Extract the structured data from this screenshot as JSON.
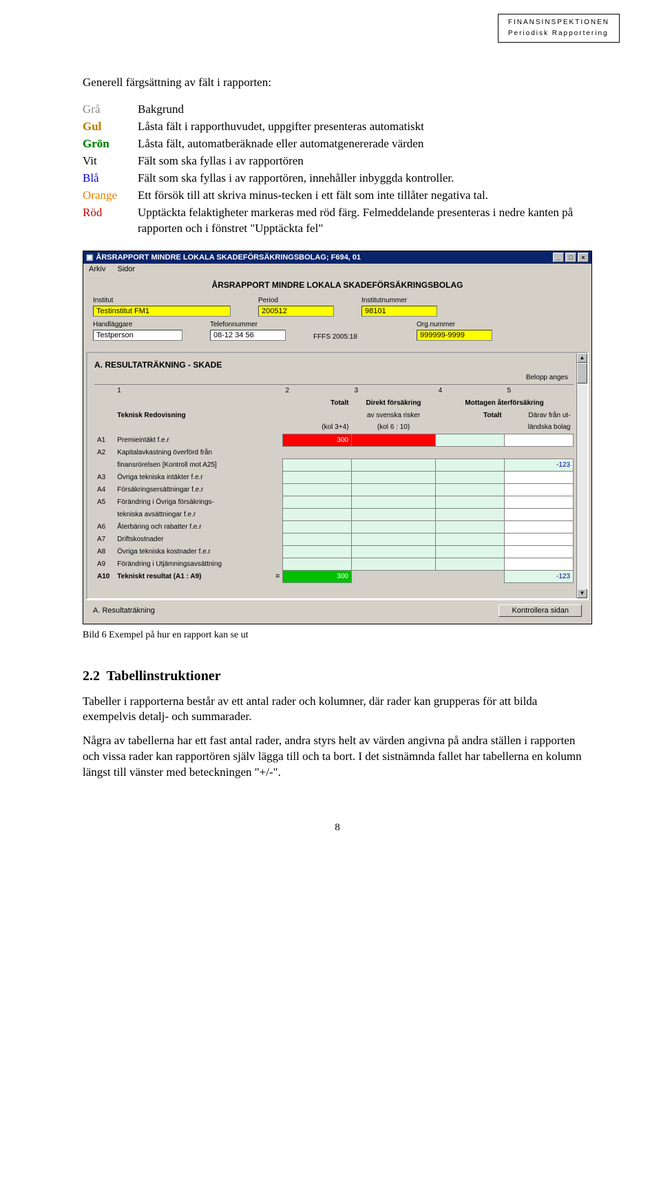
{
  "header": {
    "org": "FINANSINSPEKTIONEN",
    "sub": "Periodisk Rapportering"
  },
  "title": "Generell färgsättning av fält i rapporten:",
  "colors": [
    {
      "key": "Grå",
      "cls": "c-gra",
      "desc": "Bakgrund"
    },
    {
      "key": "Gul",
      "cls": "c-gul",
      "desc": "Låsta fält i rapporthuvudet, uppgifter presenteras automatiskt"
    },
    {
      "key": "Grön",
      "cls": "c-gron",
      "desc": "Låsta fält, automatberäknade eller automatgenererade värden"
    },
    {
      "key": "Vit",
      "cls": "c-vit",
      "desc": "Fält som ska fyllas i av rapportören"
    },
    {
      "key": "Blå",
      "cls": "c-bla",
      "desc": "Fält som ska fyllas i av rapportören, innehåller inbyggda kontroller."
    },
    {
      "key": "Orange",
      "cls": "c-orange",
      "desc": "Ett försök till att skriva minus-tecken i ett fält som inte tillåter negativa tal."
    },
    {
      "key": "Röd",
      "cls": "c-rod",
      "desc": "Upptäckta felaktigheter markeras med röd färg. Felmeddelande presenteras i nedre kanten på rapporten och i fönstret \"Upptäckta fel\""
    }
  ],
  "screenshot": {
    "titlebar": "ÅRSRAPPORT MINDRE LOKALA SKADEFÖRSÄKRINGSBOLAG; F694, 01",
    "menu": {
      "arkiv": "Arkiv",
      "sidor": "Sidor"
    },
    "main_label": "ÅRSRAPPORT MINDRE LOKALA SKADEFÖRSÄKRINGSBOLAG",
    "fields": {
      "institut_label": "Institut",
      "institut_value": "Testinstitut FM1",
      "period_label": "Period",
      "period_value": "200512",
      "institutnummer_label": "Institutnummer",
      "institutnummer_value": "98101",
      "handlaggare_label": "Handläggare",
      "handlaggare_value": "Testperson",
      "telefon_label": "Telefonnummer",
      "telefon_value": "08-12 34 56",
      "fffs": "FFFS 2005:18",
      "orgnr_label": "Org.nummer",
      "orgnr_value": "999999-9999"
    },
    "section_title": "A.  RESULTATRÄKNING - SKADE",
    "belopp": "Belopp anges",
    "table": {
      "colnums": [
        "1",
        "2",
        "3",
        "4",
        "5"
      ],
      "teknisk": "Teknisk Redovisning",
      "h_totalt": "Totalt",
      "h_direkt": "Direkt försäkring",
      "h_direkt2": "av svenska risker",
      "h_mottagen": "Mottagen återförsäkring",
      "h_mtot": "Totalt",
      "h_darav": "Därav från ut-",
      "h_darav2": "ländska bolag",
      "h_kol34": "(kol 3+4)",
      "h_kol610": "(kol 6 : 10)",
      "rows": [
        {
          "id": "A1",
          "label": "Premieintäkt f.e.r",
          "c2": "300",
          "hasRed": true
        },
        {
          "id": "A2",
          "label": "Kapitalavkastning överförd från",
          "extra": "finansrörelsen        [Kontroll mot A25]",
          "c5": "-123"
        },
        {
          "id": "A3",
          "label": "Övriga tekniska intäkter f.e.r"
        },
        {
          "id": "A4",
          "label": "Försäkringsersättningar f.e.r"
        },
        {
          "id": "A5",
          "label": "Förändring i Övriga försäkrings-",
          "extra": "tekniska avsättningar f.e.r"
        },
        {
          "id": "A6",
          "label": "Återbäring och rabatter f.e.r"
        },
        {
          "id": "A7",
          "label": "Driftskostnader"
        },
        {
          "id": "A8",
          "label": "Övriga tekniska kostnader f.e.r"
        },
        {
          "id": "A9",
          "label": "Förändring i Utjämningsavsättning"
        },
        {
          "id": "A10",
          "label": "Tekniskt resultat (A1 : A9)",
          "bold": true,
          "eq": "=",
          "c2g": "300",
          "c5b": "-123"
        }
      ]
    },
    "footer_left": "A. Resultaträkning",
    "footer_btn": "Kontrollera sidan"
  },
  "caption": "Bild  6 Exempel på hur en rapport kan se ut",
  "section_num": "2.2",
  "section_title": "Tabellinstruktioner",
  "para1": "Tabeller i rapporterna består av ett antal rader och kolumner, där rader kan grupperas för att bilda exempelvis detalj- och summarader.",
  "para2": "Några av tabellerna har ett fast antal rader, andra styrs helt av värden angivna på andra ställen i rapporten och vissa rader kan rapportören själv lägga till och ta bort. I det sistnämnda fallet har tabellerna en kolumn längst till vänster med beteckningen \"+/-\".",
  "page_number": "8"
}
